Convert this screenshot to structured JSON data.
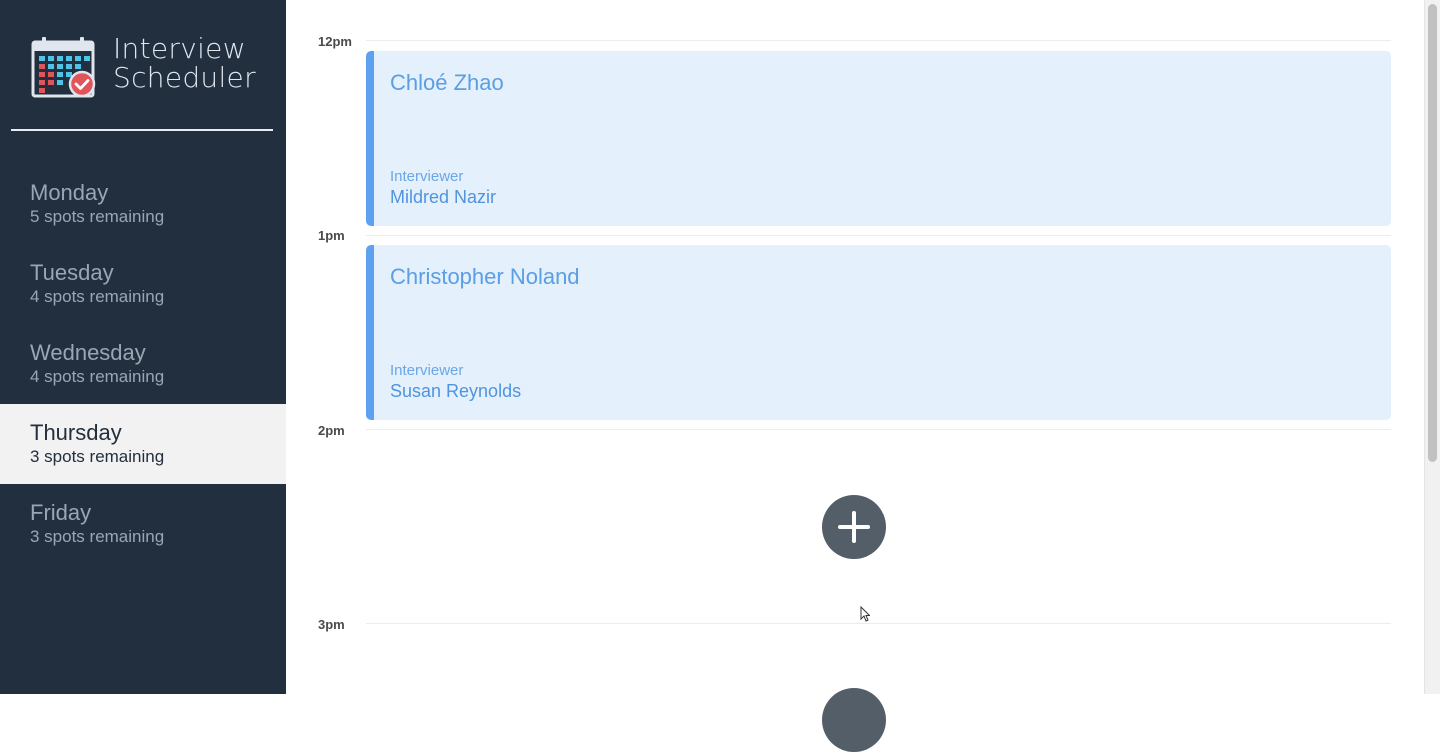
{
  "brand": {
    "title_line1": "Interview",
    "title_line2": "Scheduler",
    "logo_icon": "calendar-check-icon"
  },
  "days": [
    {
      "name": "Monday",
      "spots": "5 spots remaining",
      "selected": false
    },
    {
      "name": "Tuesday",
      "spots": "4 spots remaining",
      "selected": false
    },
    {
      "name": "Wednesday",
      "spots": "4 spots remaining",
      "selected": false
    },
    {
      "name": "Thursday",
      "spots": "3 spots remaining",
      "selected": true
    },
    {
      "name": "Friday",
      "spots": "3 spots remaining",
      "selected": false
    }
  ],
  "schedule": {
    "times": [
      "12pm",
      "1pm",
      "2pm",
      "3pm"
    ],
    "appointments": [
      {
        "time": "12pm",
        "student": "Chloé Zhao",
        "interviewer_label": "Interviewer",
        "interviewer": "Mildred Nazir"
      },
      {
        "time": "1pm",
        "student": "Christopher Noland",
        "interviewer_label": "Interviewer",
        "interviewer": "Susan Reynolds"
      }
    ],
    "empty_slots": [
      {
        "time": "2pm",
        "icon": "add-icon"
      },
      {
        "time": "3pm",
        "icon": "add-icon"
      }
    ]
  },
  "colors": {
    "sidebar_bg": "#222f3e",
    "selected_bg": "#f2f2f2",
    "appointment_bg": "#e4f0fc",
    "appointment_accent": "#5ea1ef",
    "add_button_bg": "#545e68"
  }
}
